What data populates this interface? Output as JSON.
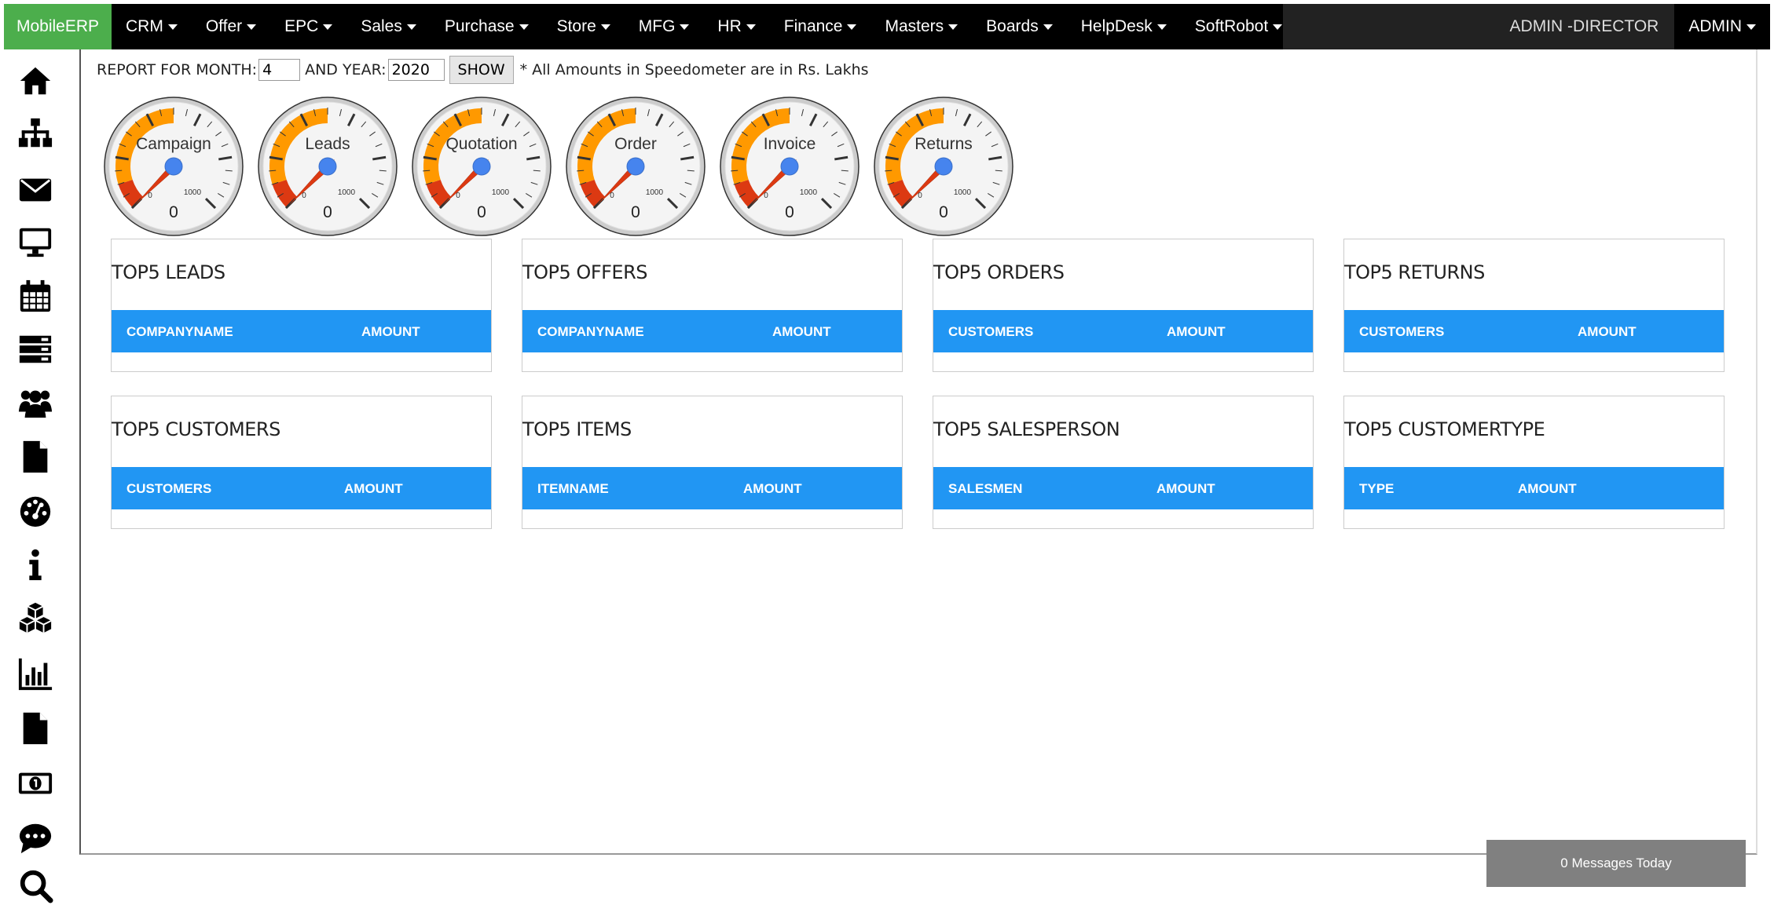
{
  "navbar": {
    "brand": "MobileERP",
    "menu": [
      {
        "label": "CRM"
      },
      {
        "label": "Offer"
      },
      {
        "label": "EPC"
      },
      {
        "label": "Sales"
      },
      {
        "label": "Purchase"
      },
      {
        "label": "Store"
      },
      {
        "label": "MFG"
      },
      {
        "label": "HR"
      },
      {
        "label": "Finance"
      },
      {
        "label": "Masters"
      },
      {
        "label": "Boards"
      },
      {
        "label": "HelpDesk"
      },
      {
        "label": "SoftRobot"
      }
    ],
    "user_role": "ADMIN -DIRECTOR",
    "admin_label": "ADMIN"
  },
  "sidebar": {
    "icons": [
      "home-icon",
      "sitemap-icon",
      "envelope-icon",
      "desktop-icon",
      "calendar-icon",
      "server-icon",
      "users-icon",
      "file-icon",
      "dashboard-icon",
      "info-icon",
      "cubes-icon",
      "bar-chart-icon",
      "document-icon",
      "money-icon",
      "comment-icon",
      "search-icon"
    ]
  },
  "report": {
    "month_label": "REPORT FOR MONTH:",
    "month_value": "4",
    "year_label": "AND YEAR:",
    "year_value": "2020",
    "show_label": "SHOW",
    "note": "* All Amounts in Speedometer are in Rs. Lakhs"
  },
  "gauges": [
    {
      "name": "Campaign",
      "value": "0",
      "max_label": "1000",
      "min_label": "0"
    },
    {
      "name": "Leads",
      "value": "0",
      "max_label": "1000",
      "min_label": "0"
    },
    {
      "name": "Quotation",
      "value": "0",
      "max_label": "1000",
      "min_label": "0"
    },
    {
      "name": "Order",
      "value": "0",
      "max_label": "1000",
      "min_label": "0"
    },
    {
      "name": "Invoice",
      "value": "0",
      "max_label": "1000",
      "min_label": "0"
    },
    {
      "name": "Returns",
      "value": "0",
      "max_label": "1000",
      "min_label": "0"
    }
  ],
  "panels": [
    {
      "title": "TOP5 LEADS",
      "col1": "COMPANYNAME",
      "col2": "AMOUNT"
    },
    {
      "title": "TOP5 OFFERS",
      "col1": "COMPANYNAME",
      "col2": "AMOUNT"
    },
    {
      "title": "TOP5 ORDERS",
      "col1": "CUSTOMERS",
      "col2": "AMOUNT"
    },
    {
      "title": "TOP5 RETURNS",
      "col1": "CUSTOMERS",
      "col2": "AMOUNT"
    },
    {
      "title": "TOP5 CUSTOMERS",
      "col1": "CUSTOMERS",
      "col2": "AMOUNT"
    },
    {
      "title": "TOP5 ITEMS",
      "col1": "ITEMNAME",
      "col2": "AMOUNT"
    },
    {
      "title": "TOP5 SALESPERSON",
      "col1": "SALESMEN",
      "col2": "AMOUNT"
    },
    {
      "title": "TOP5 CUSTOMERTYPE",
      "col1": "TYPE",
      "col2": "AMOUNT"
    }
  ],
  "messages": {
    "text": "0 Messages Today"
  },
  "colors": {
    "brand_bg": "#4cae4c",
    "navbar_bg": "#000000",
    "panel_header_bg": "#2196f3",
    "gauge_orange": "#ff9900",
    "gauge_red": "#dc3912",
    "needle": "#dc3912",
    "hub": "#4684ee"
  }
}
